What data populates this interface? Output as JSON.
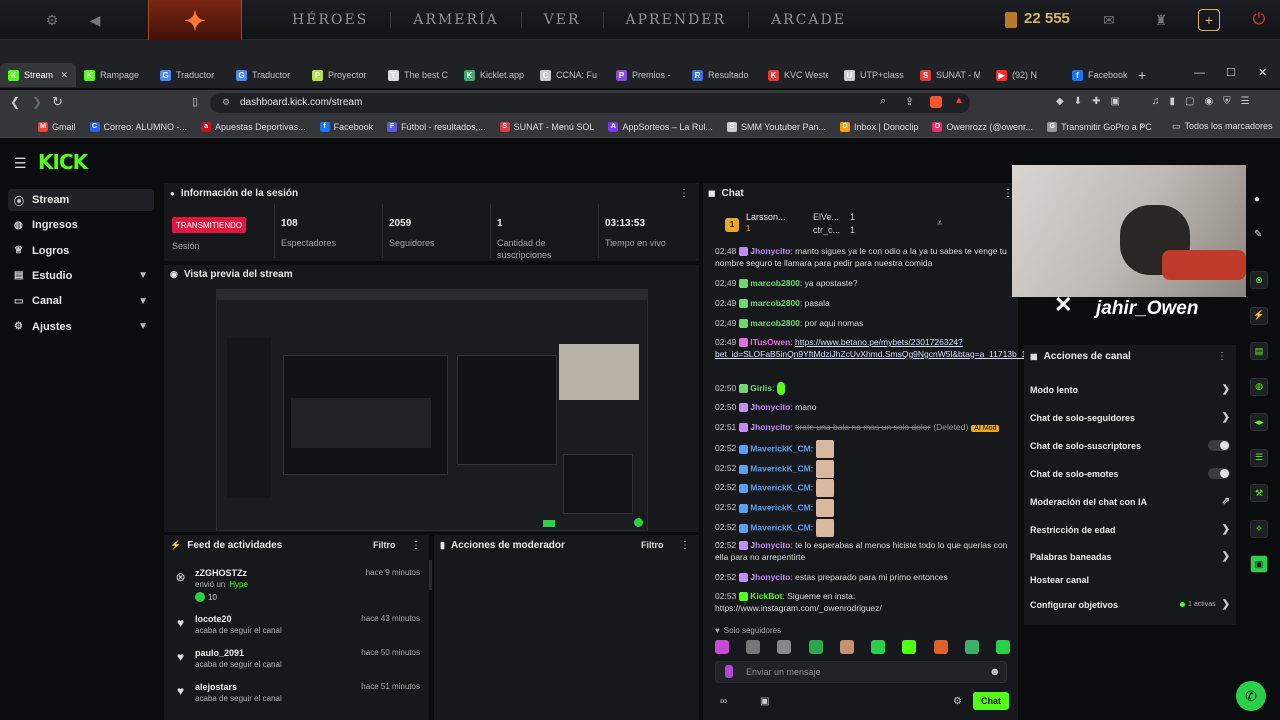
{
  "dota": {
    "nav": [
      "HÉROES",
      "ARMERÍA",
      "VER",
      "APRENDER",
      "ARCADE"
    ],
    "gold": "22 555"
  },
  "browser": {
    "tabs": [
      {
        "label": "Stream",
        "color": "#53fc18",
        "glyph": "K"
      },
      {
        "label": "Rampage",
        "color": "#53fc18",
        "glyph": "K"
      },
      {
        "label": "Traductor",
        "color": "#4a8af4",
        "glyph": "G"
      },
      {
        "label": "Traductor",
        "color": "#4a8af4",
        "glyph": "G"
      },
      {
        "label": "Proyector",
        "color": "#b6e04a",
        "glyph": "P"
      },
      {
        "label": "The best C",
        "color": "#dddddd",
        "glyph": "T"
      },
      {
        "label": "Kicklet.app",
        "color": "#3ea86a",
        "glyph": "K"
      },
      {
        "label": "CCNA: Fu",
        "color": "#cccccc",
        "glyph": "C"
      },
      {
        "label": "Premios -",
        "color": "#8a4bd6",
        "glyph": "P"
      },
      {
        "label": "Resultado",
        "color": "#3b6fe0",
        "glyph": "R"
      },
      {
        "label": "KVC Weste",
        "color": "#e03a3a",
        "glyph": "K"
      },
      {
        "label": "UTP+class",
        "color": "#cccccc",
        "glyph": "U"
      },
      {
        "label": "SUNAT - M",
        "color": "#e03a3a",
        "glyph": "S"
      },
      {
        "label": "(92) N",
        "color": "#ff2a2a",
        "glyph": "▶"
      },
      {
        "label": "Facebook",
        "color": "#1877f2",
        "glyph": "f"
      }
    ],
    "url": "dashboard.kick.com/stream",
    "bookmarks": [
      {
        "label": "Gmail",
        "color": "#ea4335",
        "glyph": "M"
      },
      {
        "label": "Correo: ALUMNO -...",
        "color": "#2563eb",
        "glyph": "C"
      },
      {
        "label": "Apuestas Deportivas...",
        "color": "#c1121f",
        "glyph": "a"
      },
      {
        "label": "Facebook",
        "color": "#1877f2",
        "glyph": "f"
      },
      {
        "label": "Fútbol - resultados,...",
        "color": "#5b5bd6",
        "glyph": "F"
      },
      {
        "label": "SUNAT - Menú SOL",
        "color": "#e03a3a",
        "glyph": "S"
      },
      {
        "label": "AppSorteos – La Rul...",
        "color": "#7c3aed",
        "glyph": "A"
      },
      {
        "label": "SMM Youtuber Pan...",
        "color": "#cccccc",
        "glyph": "S"
      },
      {
        "label": "Inbox | Donoclip",
        "color": "#f59e0b",
        "glyph": "D"
      },
      {
        "label": "Owenrozz (@owenr...",
        "color": "#e1306c",
        "glyph": "O"
      },
      {
        "label": "Transmitir GoPro a PC",
        "color": "#999999",
        "glyph": "G"
      }
    ],
    "all_bookmarks": "Todos los marcadores"
  },
  "sidebar": [
    {
      "label": "Stream",
      "icon": "stream-icon",
      "chevron": false,
      "active": true
    },
    {
      "label": "Ingresos",
      "icon": "coins-icon",
      "chevron": false
    },
    {
      "label": "Logros",
      "icon": "trophy-icon",
      "chevron": false
    },
    {
      "label": "Estudio",
      "icon": "studio-icon",
      "chevron": true
    },
    {
      "label": "Canal",
      "icon": "channel-icon",
      "chevron": true
    },
    {
      "label": "Ajustes",
      "icon": "settings-icon",
      "chevron": true
    }
  ],
  "session": {
    "title": "Información de la sesión",
    "status": "TRANSMITIENDO",
    "status_label": "Sesión",
    "stats": [
      {
        "value": "108",
        "label": "Espectadores"
      },
      {
        "value": "2059",
        "label": "Seguidores"
      },
      {
        "value": "1",
        "label": "Cantidad de suscripciones"
      },
      {
        "value": "03:13:53",
        "label": "Tiempo en vivo"
      }
    ]
  },
  "preview": {
    "title": "Vista previa del stream"
  },
  "feed": {
    "title": "Feed de actividades",
    "filter": "Filtro",
    "items": [
      {
        "name": "zZGHOSTZz",
        "desc": "envió un",
        "tag": "Hype",
        "extra": "10",
        "time": "hace 9 minutos",
        "icon": "x-icon"
      },
      {
        "name": "locote20",
        "desc": "acaba de seguir el canal",
        "time": "hace 43 minutos",
        "icon": "heart-icon"
      },
      {
        "name": "paulo_2091",
        "desc": "acaba de seguir el canal",
        "time": "hace 50 minutos",
        "icon": "heart-icon"
      },
      {
        "name": "alejostars",
        "desc": "acaba de seguir el canal",
        "time": "hace 51 minutos",
        "icon": "heart-icon"
      }
    ]
  },
  "mod": {
    "title": "Acciones de moderador",
    "filter": "Filtro"
  },
  "chat": {
    "title": "Chat",
    "top": [
      {
        "name": "Larsson...",
        "count": "1"
      },
      {
        "name": "ElVe...",
        "count": "1"
      },
      {
        "name": "ctr_c...",
        "count": "1"
      }
    ],
    "lines": [
      {
        "time": "02:48",
        "user": "Jhonycito",
        "ucolor": "#c38cf5",
        "text": "manto sigues ya le con odio a la ya tu sabes te venge tu nombre seguro te llamara para pedir para nuestra comida"
      },
      {
        "time": "02:49",
        "user": "marcob2800",
        "ucolor": "#6fd96f",
        "text": "ya apostaste?"
      },
      {
        "time": "02:49",
        "user": "marcob2800",
        "ucolor": "#6fd96f",
        "text": "pasala"
      },
      {
        "time": "02:49",
        "user": "marcob2800",
        "ucolor": "#6fd96f",
        "text": "por aqui nomas"
      },
      {
        "time": "02:49",
        "user": "ITusOwen",
        "ucolor": "#e86ce0",
        "text": "https://www.betano.pe/mybets/2301726324?bet_id=SLOFaB5inQn9YftMdziJhZcUvXhmd.SmsQg9NgcnW5l&btag=a_11713b_1602c"
      },
      {
        "time": "02:50",
        "user": "Girlis",
        "ucolor": "#6fd96f",
        "text": ""
      },
      {
        "time": "02:50",
        "user": "Jhonycito",
        "ucolor": "#c38cf5",
        "text": "mano"
      },
      {
        "time": "02:51",
        "user": "Jhonycito",
        "ucolor": "#c38cf5",
        "text": "tirate una bala no mas un solo dolor",
        "deleted": "(Deleted)",
        "badge": "AI Mod"
      },
      {
        "time": "02:52",
        "user": "MaverickK_CM",
        "ucolor": "#5aa0f0",
        "text": ""
      },
      {
        "time": "02:52",
        "user": "MaverickK_CM",
        "ucolor": "#5aa0f0",
        "text": ""
      },
      {
        "time": "02:52",
        "user": "MaverickK_CM",
        "ucolor": "#5aa0f0",
        "text": ""
      },
      {
        "time": "02:52",
        "user": "MaverickK_CM",
        "ucolor": "#5aa0f0",
        "text": ""
      },
      {
        "time": "02:52",
        "user": "MaverickK_CM",
        "ucolor": "#5aa0f0",
        "text": ""
      },
      {
        "time": "02:52",
        "user": "Jhonycito",
        "ucolor": "#c38cf5",
        "text": "te lo esperabas al menos hiciste todo lo que querias con ella para no arrepentirte"
      },
      {
        "time": "02:52",
        "user": "Jhonycito",
        "ucolor": "#c38cf5",
        "text": "estas preparado para mi primo entonces"
      },
      {
        "time": "02:53",
        "user": "KickBot",
        "ucolor": "#53fc18",
        "text": "Sigueme en insta: https://www.instagram.com/_owenrodriguez/"
      }
    ],
    "followers_only": "Solo seguidores",
    "placeholder": "Enviar un mensaje",
    "send": "Chat"
  },
  "overlay": {
    "handle": "jahir_Owen"
  },
  "actions": {
    "title": "Acciones de canal",
    "items": [
      {
        "label": "Modo lento",
        "ctrl": "chevron"
      },
      {
        "label": "Chat de solo-seguidores",
        "ctrl": "chevron"
      },
      {
        "label": "Chat de solo-suscriptores",
        "ctrl": "toggle"
      },
      {
        "label": "Chat de solo-emotes",
        "ctrl": "toggle"
      },
      {
        "label": "Moderación del chat con IA",
        "ctrl": "chart"
      },
      {
        "label": "Restricción de edad",
        "ctrl": "chevron"
      },
      {
        "label": "Palabras baneadas",
        "ctrl": "chevron"
      },
      {
        "label": "Hostear canal",
        "ctrl": "none"
      },
      {
        "label": "Configurar objetivos",
        "ctrl": "chevron",
        "note": "1 activas"
      }
    ]
  },
  "colors": {
    "kick_green": "#53fc18",
    "live_red": "#e1173f",
    "panel": "#17181b",
    "page": "#0b0c0e"
  }
}
